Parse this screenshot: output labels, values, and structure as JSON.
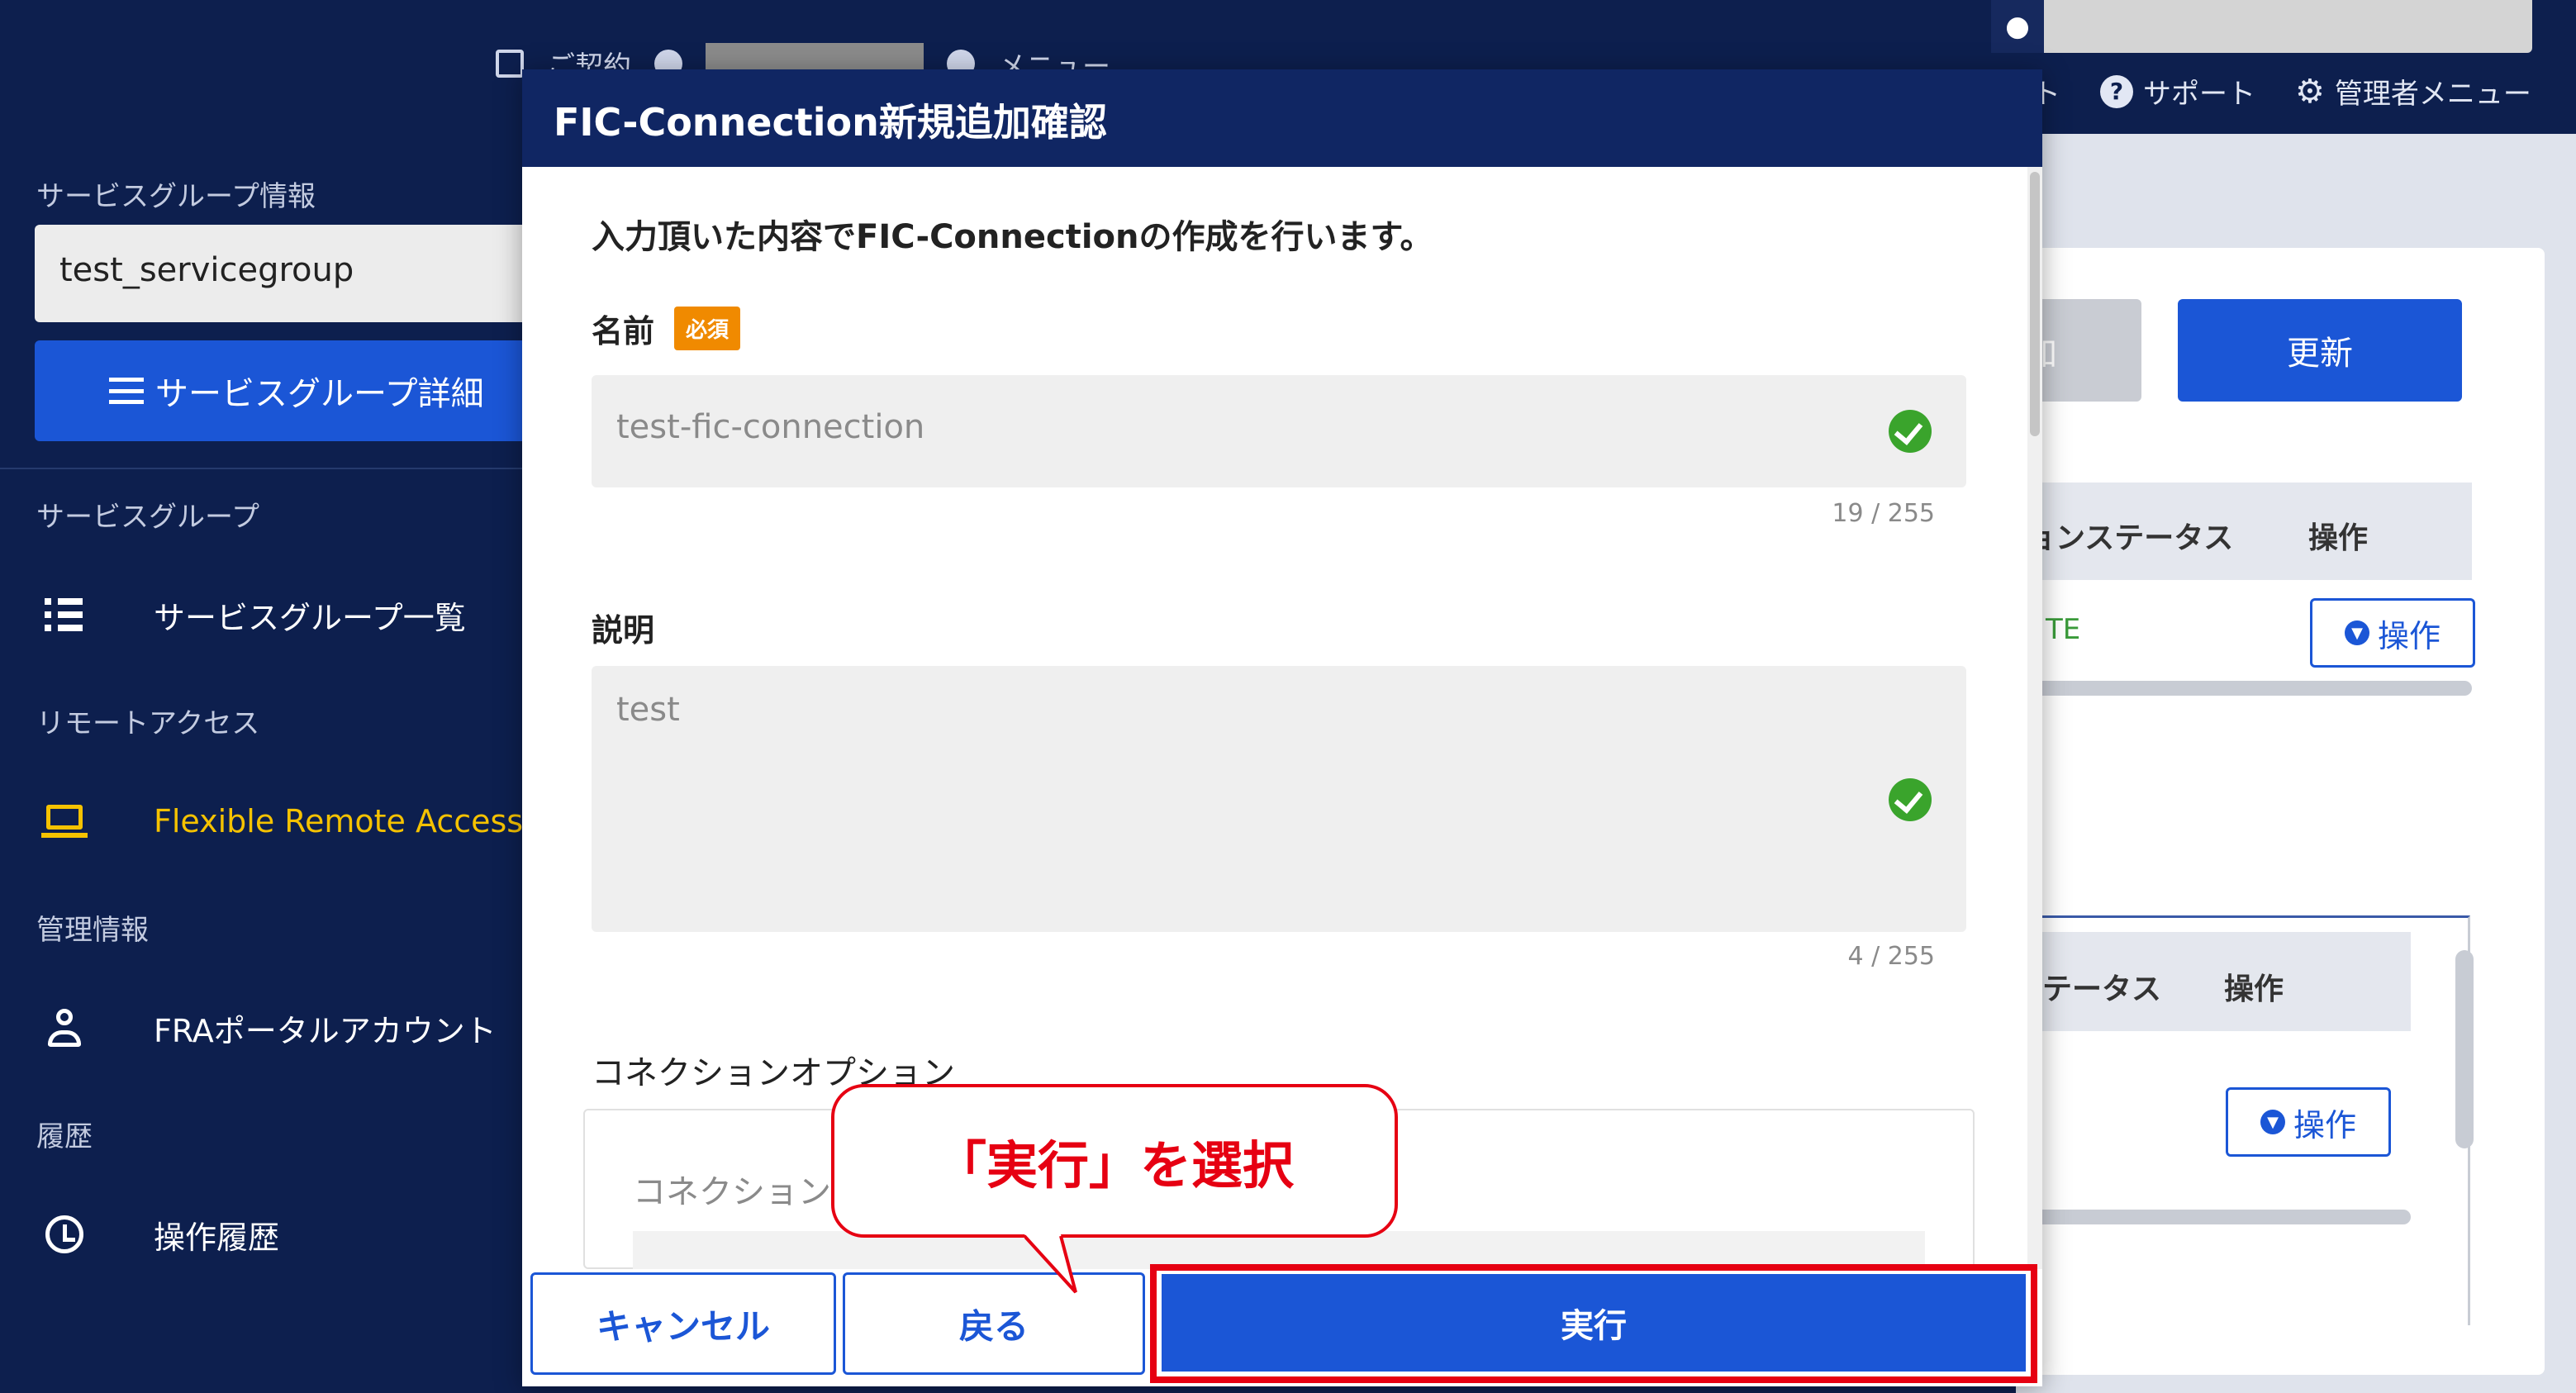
{
  "header": {
    "crumb_text": "ご契約",
    "crumb_menu": "メニュー",
    "links": {
      "partial_left": "ト",
      "support": "サポート",
      "admin_menu": "管理者メニュー"
    }
  },
  "sidebar": {
    "service_group_info_label": "サービスグループ情報",
    "selected_service_group": "test_servicegroup",
    "detail_button": "サービスグループ詳細",
    "sections": {
      "service_group": "サービスグループ",
      "remote_access": "リモートアクセス",
      "management": "管理情報",
      "history": "履歴"
    },
    "items": {
      "service_group_list": "サービスグループ一覧",
      "flexible_remote_access": "Flexible Remote Access",
      "fra_portal_account": "FRAポータルアカウント",
      "operation_history": "操作履歴"
    }
  },
  "background": {
    "add_button_partial": "加",
    "update_button": "更新",
    "table1": {
      "col_status": "ョンステータス",
      "col_operation": "操作",
      "status_value": "TE",
      "op_button": "操作"
    },
    "table2": {
      "col_status": "テータス",
      "col_operation": "操作",
      "op_button": "操作"
    }
  },
  "modal": {
    "title": "FIC-Connection新規追加確認",
    "intro": "入力頂いた内容でFIC-Connectionの作成を行います。",
    "name_field": {
      "label": "名前",
      "required_badge": "必須",
      "value": "test-fic-connection",
      "counter": "19 / 255"
    },
    "description_field": {
      "label": "説明",
      "value": "test",
      "counter": "4 / 255"
    },
    "connection_options": {
      "title": "コネクションオプション",
      "sub_label": "コネクション"
    },
    "footer": {
      "cancel": "キャンセル",
      "back": "戻る",
      "execute": "実行"
    }
  },
  "callout": {
    "text": "「実行」を選択"
  },
  "colors": {
    "navy": "#0d1f4e",
    "modal_header": "#102663",
    "primary_blue": "#1b56d6",
    "highlight_red": "#e60012",
    "required_orange": "#f08a00",
    "valid_green": "#3aa42c",
    "active_nav_yellow": "#f5c200"
  }
}
